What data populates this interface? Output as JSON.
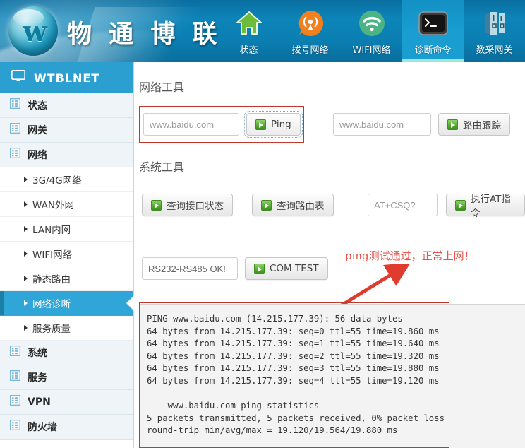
{
  "header": {
    "brand": "物 通 博 联",
    "logo_icon": "company-sphere-logo",
    "tabs": [
      {
        "label": "状态",
        "icon": "home-icon",
        "active": false
      },
      {
        "label": "拨号网络",
        "icon": "signal-tower-icon",
        "active": false
      },
      {
        "label": "WIFI网络",
        "icon": "wifi-icon",
        "active": false
      },
      {
        "label": "诊断命令",
        "icon": "terminal-icon",
        "active": true
      },
      {
        "label": "数采网关",
        "icon": "server-rack-icon",
        "active": false
      }
    ]
  },
  "sidebar": {
    "title": "WTBLNET",
    "title_icon": "monitor-icon",
    "items": [
      {
        "label": "状态",
        "icon": "grid-icon",
        "type": "group"
      },
      {
        "label": "网关",
        "icon": "grid-icon",
        "type": "group"
      },
      {
        "label": "网络",
        "icon": "grid-icon",
        "type": "group"
      },
      {
        "label": "3G/4G网络",
        "type": "sub",
        "active": false
      },
      {
        "label": "WAN外网",
        "type": "sub",
        "active": false
      },
      {
        "label": "LAN内网",
        "type": "sub",
        "active": false
      },
      {
        "label": "WIFI网络",
        "type": "sub",
        "active": false
      },
      {
        "label": "静态路由",
        "type": "sub",
        "active": false
      },
      {
        "label": "网络诊断",
        "type": "sub",
        "active": true
      },
      {
        "label": "服务质量",
        "type": "sub",
        "active": false
      },
      {
        "label": "系统",
        "icon": "grid-icon",
        "type": "group"
      },
      {
        "label": "服务",
        "icon": "grid-icon",
        "type": "group"
      },
      {
        "label": "VPN",
        "icon": "grid-icon",
        "type": "group"
      },
      {
        "label": "防火墙",
        "icon": "grid-icon",
        "type": "group"
      }
    ]
  },
  "main": {
    "network_tools": {
      "title": "网络工具",
      "ping_input_value": "www.baidu.com",
      "ping_button": "Ping",
      "traceroute_input_value": "www.baidu.com",
      "traceroute_button": "路由跟踪"
    },
    "system_tools": {
      "title": "系统工具",
      "iface_status_button": "查询接口状态",
      "route_table_button": "查询路由表",
      "at_input_value": "AT+CSQ?",
      "at_exec_button": "执行AT指令",
      "com_input_value": "RS232-RS485 OK!",
      "com_test_button": "COM TEST"
    },
    "annotation": "ping测试通过，正常上网！",
    "output": "PING www.baidu.com (14.215.177.39): 56 data bytes\n64 bytes from 14.215.177.39: seq=0 ttl=55 time=19.860 ms\n64 bytes from 14.215.177.39: seq=1 ttl=55 time=19.640 ms\n64 bytes from 14.215.177.39: seq=2 ttl=55 time=19.320 ms\n64 bytes from 14.215.177.39: seq=3 ttl=55 time=19.880 ms\n64 bytes from 14.215.177.39: seq=4 ttl=55 time=19.120 ms\n\n--- www.baidu.com ping statistics ---\n5 packets transmitted, 5 packets received, 0% packet loss\nround-trip min/avg/max = 19.120/19.564/19.880 ms"
  },
  "colors": {
    "header_blue": "#0d84b8",
    "sidebar_accent": "#2a9fd0",
    "active_item": "#2fa5d8",
    "annotation_red": "#e8534a",
    "highlight_box": "#c0392b",
    "button_green": "#57ad33"
  }
}
